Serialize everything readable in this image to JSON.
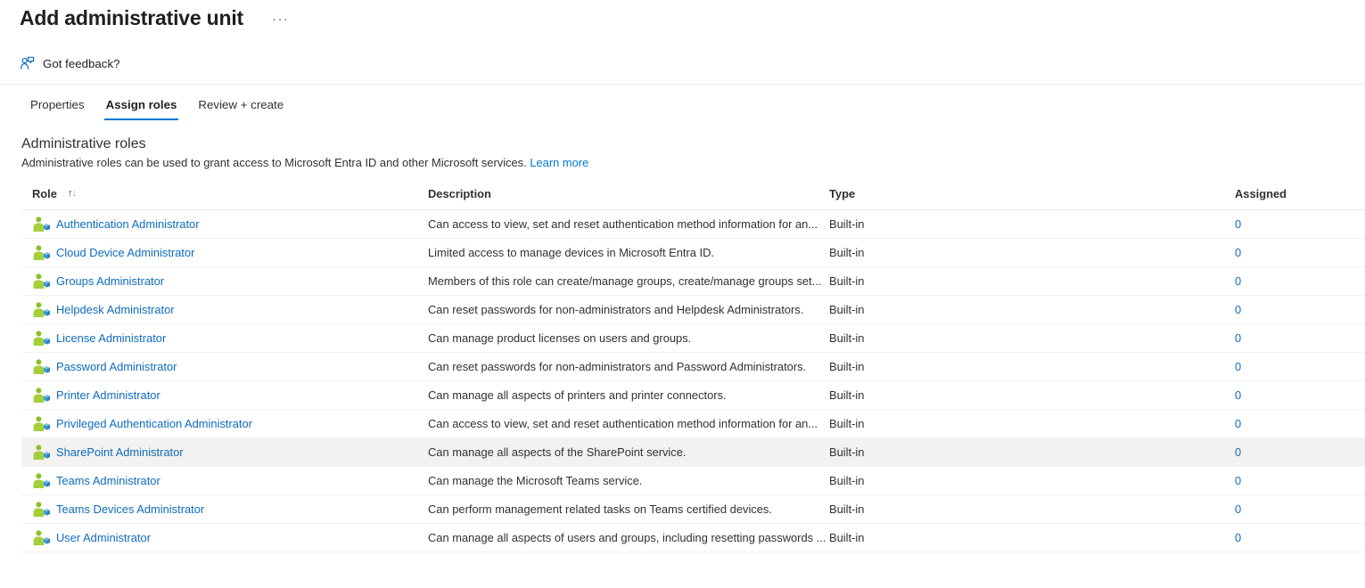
{
  "header": {
    "title": "Add administrative unit",
    "overflow_menu": "···"
  },
  "command_bar": {
    "feedback_label": "Got feedback?",
    "feedback_icon": "feedback-person-icon"
  },
  "tabs": [
    {
      "label": "Properties",
      "active": false
    },
    {
      "label": "Assign roles",
      "active": true
    },
    {
      "label": "Review + create",
      "active": false
    }
  ],
  "section": {
    "title": "Administrative roles",
    "description": "Administrative roles can be used to grant access to Microsoft Entra ID and other Microsoft services.",
    "learn_more": "Learn more"
  },
  "table": {
    "columns": {
      "role": "Role",
      "description": "Description",
      "type": "Type",
      "assigned": "Assigned"
    },
    "sort_column": "Role",
    "rows": [
      {
        "role": "Authentication Administrator",
        "description": "Can access to view, set and reset authentication method information for an...",
        "type": "Built-in",
        "assigned": "0",
        "hovered": false
      },
      {
        "role": "Cloud Device Administrator",
        "description": "Limited access to manage devices in Microsoft Entra ID.",
        "type": "Built-in",
        "assigned": "0",
        "hovered": false
      },
      {
        "role": "Groups Administrator",
        "description": "Members of this role can create/manage groups, create/manage groups set...",
        "type": "Built-in",
        "assigned": "0",
        "hovered": false
      },
      {
        "role": "Helpdesk Administrator",
        "description": "Can reset passwords for non-administrators and Helpdesk Administrators.",
        "type": "Built-in",
        "assigned": "0",
        "hovered": false
      },
      {
        "role": "License Administrator",
        "description": "Can manage product licenses on users and groups.",
        "type": "Built-in",
        "assigned": "0",
        "hovered": false
      },
      {
        "role": "Password Administrator",
        "description": "Can reset passwords for non-administrators and Password Administrators.",
        "type": "Built-in",
        "assigned": "0",
        "hovered": false
      },
      {
        "role": "Printer Administrator",
        "description": "Can manage all aspects of printers and printer connectors.",
        "type": "Built-in",
        "assigned": "0",
        "hovered": false
      },
      {
        "role": "Privileged Authentication Administrator",
        "description": "Can access to view, set and reset authentication method information for an...",
        "type": "Built-in",
        "assigned": "0",
        "hovered": false
      },
      {
        "role": "SharePoint Administrator",
        "description": "Can manage all aspects of the SharePoint service.",
        "type": "Built-in",
        "assigned": "0",
        "hovered": true
      },
      {
        "role": "Teams Administrator",
        "description": "Can manage the Microsoft Teams service.",
        "type": "Built-in",
        "assigned": "0",
        "hovered": false
      },
      {
        "role": "Teams Devices Administrator",
        "description": "Can perform management related tasks on Teams certified devices.",
        "type": "Built-in",
        "assigned": "0",
        "hovered": false
      },
      {
        "role": "User Administrator",
        "description": "Can manage all aspects of users and groups, including resetting passwords ...",
        "type": "Built-in",
        "assigned": "0",
        "hovered": false
      }
    ]
  },
  "colors": {
    "accent": "#0078d4",
    "link": "#0f6cbd",
    "row_hover": "#f3f2f1",
    "divider": "#edebe9",
    "icon_green": "#8cbf26",
    "icon_blue": "#40a3e0"
  }
}
